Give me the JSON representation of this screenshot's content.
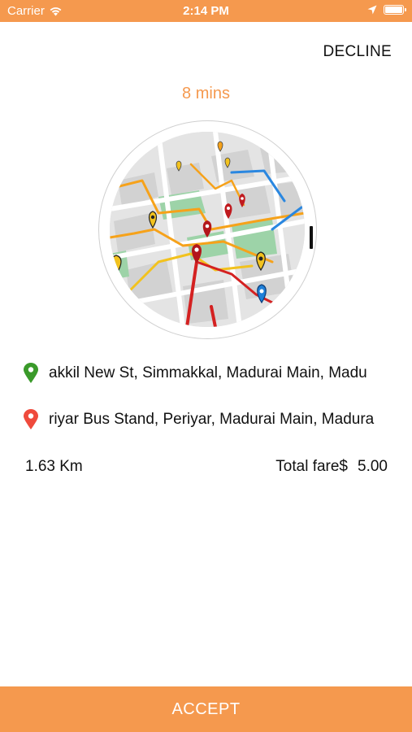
{
  "status_bar": {
    "carrier": "Carrier",
    "time": "2:14 PM"
  },
  "header": {
    "decline_label": "DECLINE"
  },
  "eta": "8 mins",
  "map": {
    "icon": "city-map-with-route-pins"
  },
  "pickup": {
    "icon": "green-location-pin",
    "address": "Simmakkal New St, Simmakkal, Madurai Main, Madurai",
    "visible_address": "akkil New St, Simmakkal, Madurai Main, Madu"
  },
  "dropoff": {
    "icon": "red-location-pin",
    "address": "Periyar Bus Stand, Periyar, Madurai Main, Madurai",
    "visible_address": "riyar Bus Stand, Periyar, Madurai Main, Madura"
  },
  "trip": {
    "distance": "1.63 Km",
    "fare_label": "Total fare$",
    "fare_amount": "5.00"
  },
  "footer": {
    "accept_label": "ACCEPT"
  },
  "colors": {
    "accent": "#f5994e",
    "pickup_pin": "#3a9a2a",
    "dropoff_pin": "#ef4a3c"
  }
}
